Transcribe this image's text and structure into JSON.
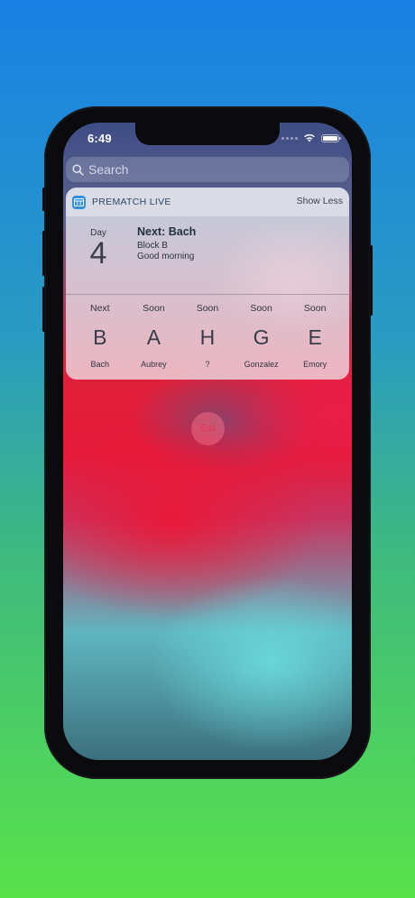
{
  "status_bar": {
    "time": "6:49"
  },
  "search": {
    "placeholder": "Search"
  },
  "widget": {
    "app_name": "PREMATCH LIVE",
    "show_less_label": "Show Less",
    "day_label": "Day",
    "day_number": "4",
    "next_title": "Next: Bach",
    "next_block": "Block B",
    "greeting": "Good morning",
    "schedule": [
      {
        "head": "Next",
        "letter": "B",
        "name": "Bach"
      },
      {
        "head": "Soon",
        "letter": "A",
        "name": "Aubrey"
      },
      {
        "head": "Soon",
        "letter": "H",
        "name": "?"
      },
      {
        "head": "Soon",
        "letter": "G",
        "name": "Gonzalez"
      },
      {
        "head": "Soon",
        "letter": "E",
        "name": "Emory"
      }
    ]
  },
  "edit_label": "Edit",
  "colors": {
    "app_icon": "#2f8fe0",
    "edit_text": "#e5344d"
  }
}
